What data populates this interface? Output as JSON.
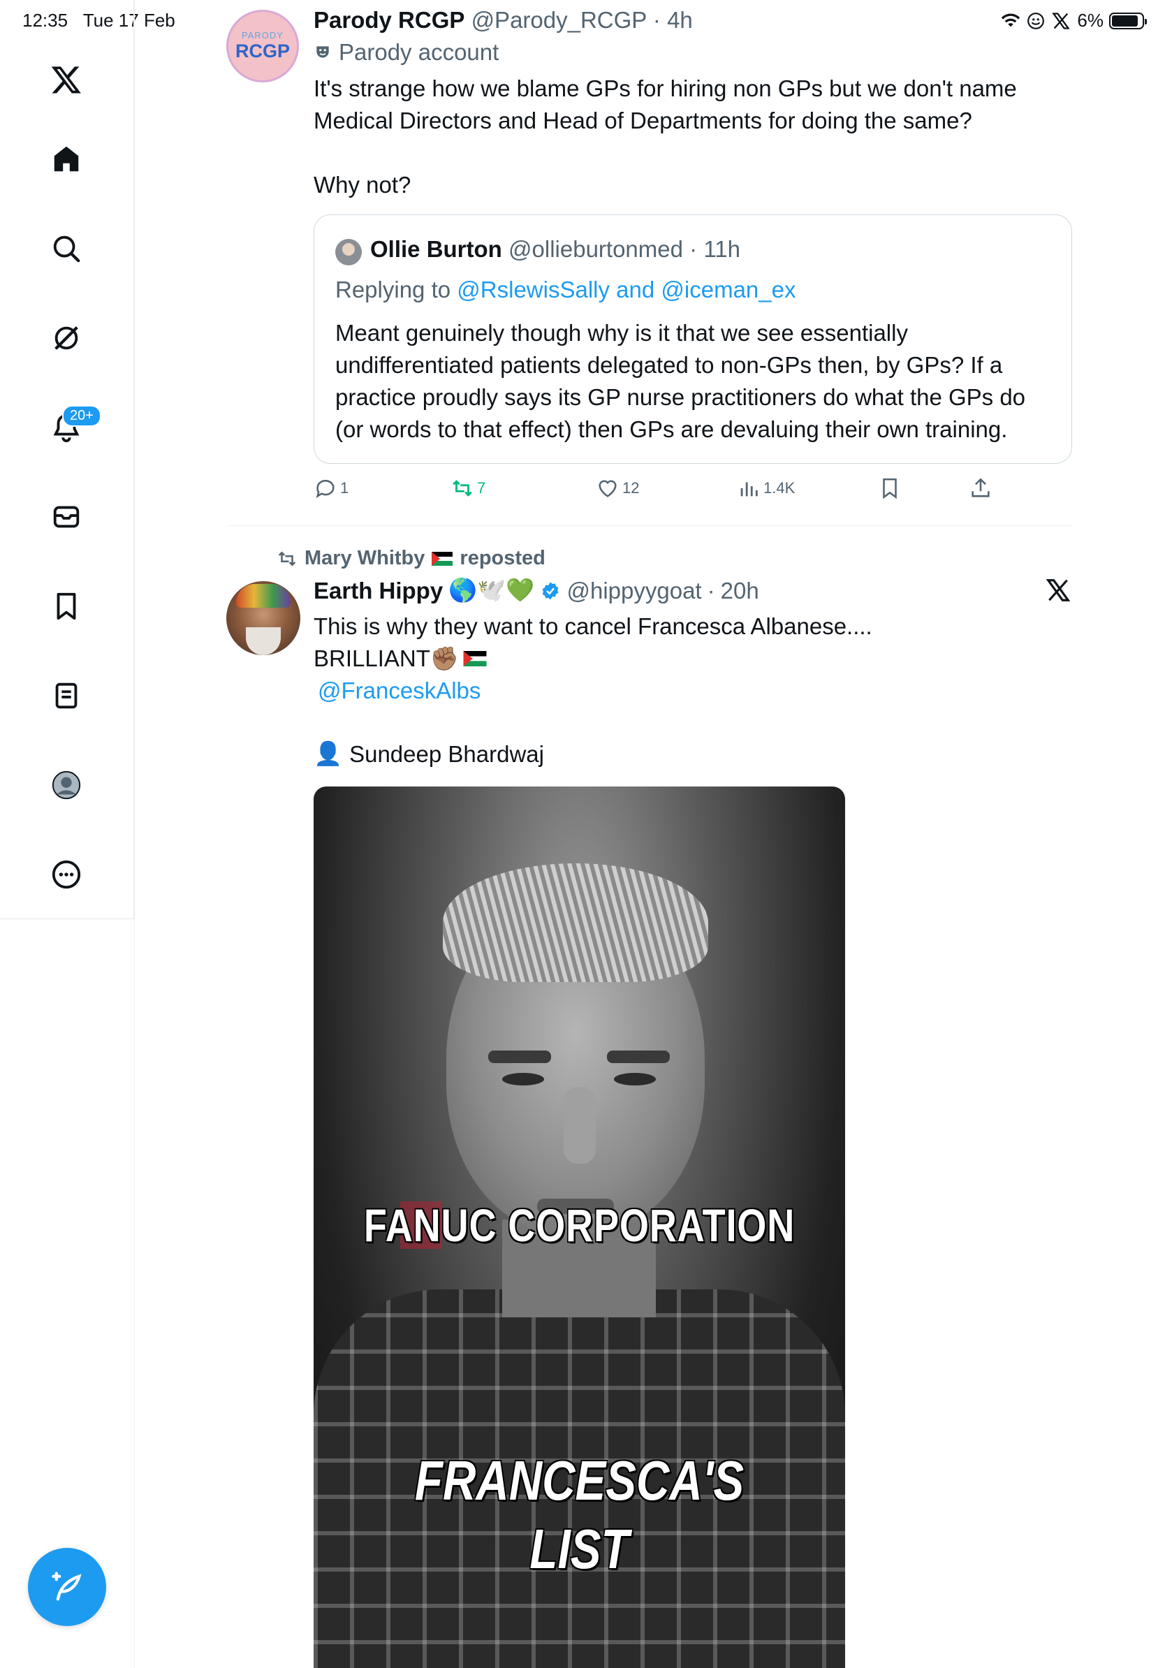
{
  "status_bar": {
    "time": "12:35",
    "date": "Tue 17 Feb",
    "battery": "6%"
  },
  "sidebar": {
    "notification_badge": "20+"
  },
  "tweet1": {
    "display_name": "Parody RCGP",
    "handle": "@Parody_RCGP",
    "time": "4h",
    "parody_label": "Parody account",
    "avatar_small": "PARODY",
    "avatar_big": "RCGP",
    "body_line1": "It's strange how we blame GPs for hiring non GPs but we don't name",
    "body_line2": "Medical Directors and Head of Departments for doing the same?",
    "body_line3": "Why not?",
    "quote": {
      "display_name": "Ollie Burton",
      "handle": "@ollieburtonmed",
      "time": "11h",
      "replying_prefix": "Replying to",
      "reply_user1": "@RslewisSally",
      "reply_and": "and",
      "reply_user2": "@iceman_ex",
      "body_line1": "Meant genuinely though why is it that we see essentially",
      "body_line2": "undifferentiated patients delegated to non-GPs then, by GPs? If a",
      "body_line3": "practice proudly says its GP nurse practitioners do what the GPs do",
      "body_line4": "(or words to that effect) then GPs are devaluing their own training."
    },
    "actions": {
      "replies": "1",
      "reposts": "7",
      "likes": "12",
      "views": "1.4K"
    }
  },
  "tweet2": {
    "reposted_by": "Mary Whitby",
    "reposted_label": "reposted",
    "display_name": "Earth Hippy",
    "name_emojis": "🌎🕊️💚",
    "handle": "@hippyygoat",
    "time": "20h",
    "body_line1": "This is why they want to cancel Francesca Albanese....",
    "body_line2": "BRILLIANT✊🏽",
    "mention": "@FranceskAlbs",
    "user_emoji": "👤",
    "user_name": "Sundeep Bhardwaj",
    "media": {
      "caption1": "FANUC CORPORATION",
      "caption2": "FRANCESCA'S",
      "caption3": "LIST"
    }
  },
  "colors": {
    "accent": "#1d9bf0",
    "repost_green": "#00ba7c",
    "muted": "#536471"
  }
}
